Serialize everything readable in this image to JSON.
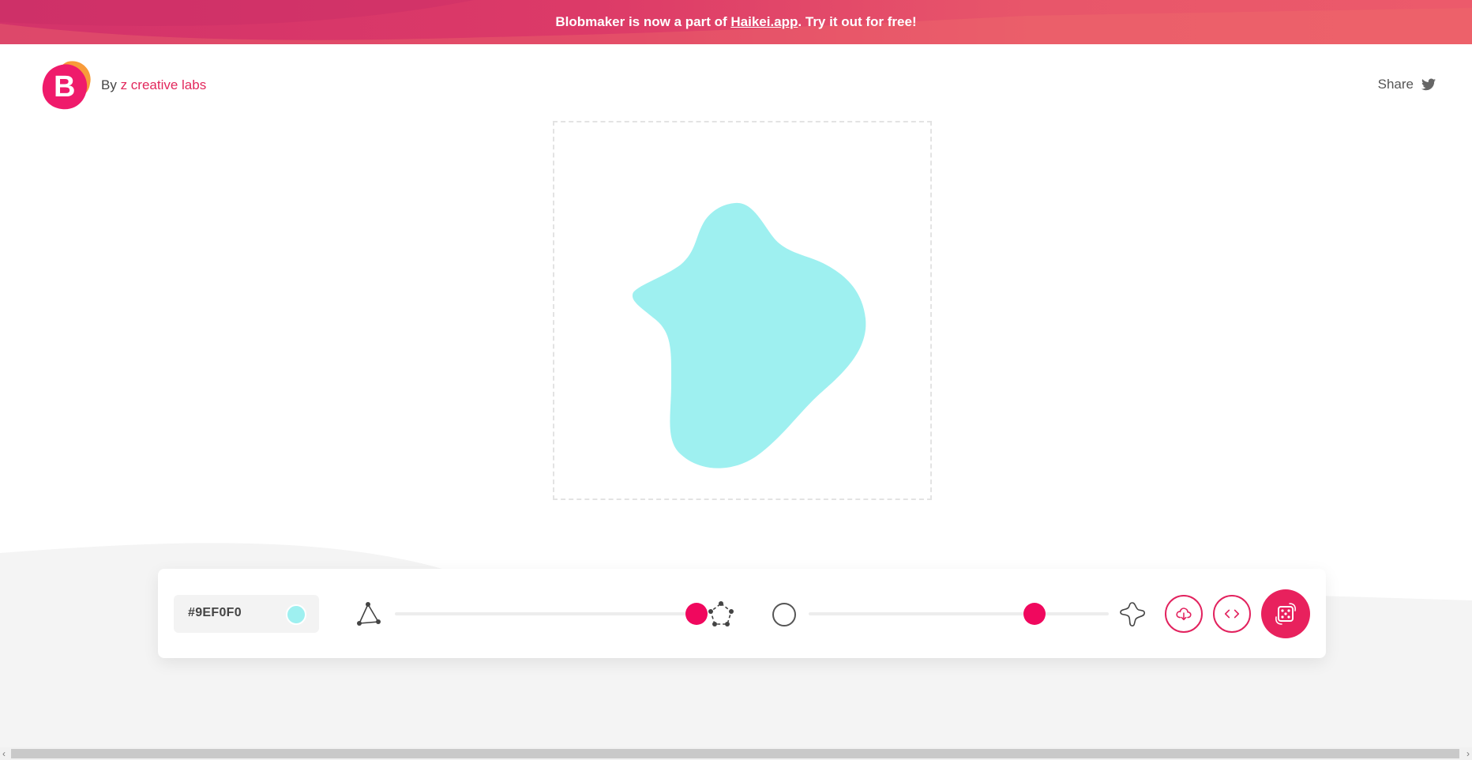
{
  "banner": {
    "text_before": "Blobmaker is now a part of ",
    "link_text": "Haikei.app",
    "text_after": ". Try it out for free!"
  },
  "header": {
    "logo_letter": "B",
    "by_label": "By ",
    "brand": "z creative labs",
    "share_label": "Share",
    "share_icon": "twitter-icon"
  },
  "blob": {
    "fill_color": "#9EF0F0"
  },
  "controls": {
    "color_hex": "#9EF0F0",
    "complexity": {
      "min_icon": "triangle-points-icon",
      "max_icon": "pentagon-points-icon",
      "value": 1.0
    },
    "contrast": {
      "min_icon": "circle-icon",
      "max_icon": "star-blob-icon",
      "value": 0.72
    },
    "download_icon": "cloud-download-icon",
    "code_icon": "code-icon",
    "random_icon": "dice-icon"
  },
  "colors": {
    "accent": "#F0085E",
    "banner": "#D3336A"
  }
}
